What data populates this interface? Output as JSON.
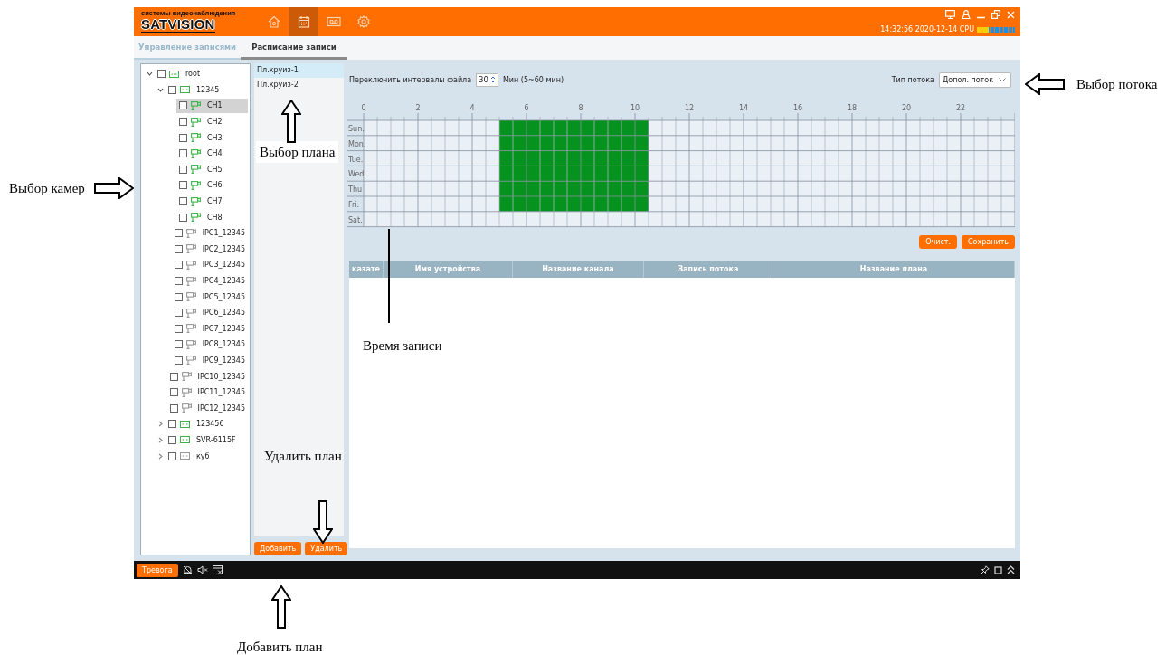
{
  "header": {
    "logo_tagline": "системы видеонаблюдения",
    "logo_brand": "SATVISION",
    "nav": [
      {
        "kind": "home",
        "selected": false
      },
      {
        "kind": "schedule",
        "selected": true
      },
      {
        "kind": "playback",
        "selected": false
      },
      {
        "kind": "settings",
        "selected": false
      }
    ],
    "clock": "14:32:56 2020-12-14 CPU",
    "cpu": {
      "level": 0.3
    }
  },
  "tabs": [
    {
      "label": "Управление записями",
      "selected": false
    },
    {
      "label": "Расписание записи",
      "selected": true
    }
  ],
  "tree": [
    {
      "kind": "device",
      "label": "root",
      "online": true,
      "checked": false,
      "expanded": true,
      "selected": false,
      "children": [
        {
          "kind": "device",
          "label": "12345",
          "online": true,
          "checked": false,
          "expanded": true,
          "selected": false,
          "children": [
            {
              "kind": "camera",
              "label": "CH1",
              "online": true,
              "checked": false,
              "selected": true
            },
            {
              "kind": "camera",
              "label": "CH2",
              "online": true,
              "checked": false,
              "selected": false
            },
            {
              "kind": "camera",
              "label": "CH3",
              "online": true,
              "checked": false,
              "selected": false
            },
            {
              "kind": "camera",
              "label": "CH4",
              "online": true,
              "checked": false,
              "selected": false
            },
            {
              "kind": "camera",
              "label": "CH5",
              "online": true,
              "checked": false,
              "selected": false
            },
            {
              "kind": "camera",
              "label": "CH6",
              "online": true,
              "checked": false,
              "selected": false
            },
            {
              "kind": "camera",
              "label": "CH7",
              "online": true,
              "checked": false,
              "selected": false
            },
            {
              "kind": "camera",
              "label": "CH8",
              "online": true,
              "checked": false,
              "selected": false
            },
            {
              "kind": "camera",
              "label": "IPC1_12345",
              "online": false,
              "checked": false,
              "selected": false
            },
            {
              "kind": "camera",
              "label": "IPC2_12345",
              "online": false,
              "checked": false,
              "selected": false
            },
            {
              "kind": "camera",
              "label": "IPC3_12345",
              "online": false,
              "checked": false,
              "selected": false
            },
            {
              "kind": "camera",
              "label": "IPC4_12345",
              "online": false,
              "checked": false,
              "selected": false
            },
            {
              "kind": "camera",
              "label": "IPC5_12345",
              "online": false,
              "checked": false,
              "selected": false
            },
            {
              "kind": "camera",
              "label": "IPC6_12345",
              "online": false,
              "checked": false,
              "selected": false
            },
            {
              "kind": "camera",
              "label": "IPC7_12345",
              "online": false,
              "checked": false,
              "selected": false
            },
            {
              "kind": "camera",
              "label": "IPC8_12345",
              "online": false,
              "checked": false,
              "selected": false
            },
            {
              "kind": "camera",
              "label": "IPC9_12345",
              "online": false,
              "checked": false,
              "selected": false
            },
            {
              "kind": "camera",
              "label": "IPC10_12345",
              "online": false,
              "checked": false,
              "selected": false
            },
            {
              "kind": "camera",
              "label": "IPC11_12345",
              "online": false,
              "checked": false,
              "selected": false
            },
            {
              "kind": "camera",
              "label": "IPC12_12345",
              "online": false,
              "checked": false,
              "selected": false
            }
          ]
        },
        {
          "kind": "device",
          "label": "123456",
          "online": true,
          "checked": false,
          "expanded": false,
          "selected": false
        },
        {
          "kind": "device",
          "label": "SVR-6115F",
          "online": true,
          "checked": false,
          "expanded": false,
          "selected": false
        },
        {
          "kind": "device",
          "label": "куб",
          "online": false,
          "checked": false,
          "expanded": false,
          "selected": false
        }
      ]
    }
  ],
  "plans": {
    "items": [
      {
        "label": "Пл.круиз-1",
        "selected": true
      },
      {
        "label": "Пл.круиз-2",
        "selected": false
      }
    ],
    "add_button": "Добавить",
    "delete_button": "Удалить"
  },
  "settings": {
    "interval_label": "Переключить интервалы файла",
    "interval_value": "30",
    "interval_hint": "Мин (5~60 мин)",
    "stream_label": "Тип потока",
    "stream_value": "Допол. поток"
  },
  "schedule": {
    "hours": [
      "0",
      "2",
      "4",
      "6",
      "8",
      "10",
      "12",
      "14",
      "16",
      "18",
      "20",
      "22"
    ],
    "days": [
      {
        "day": "Sun.",
        "slots": [
          false,
          false,
          false,
          false,
          false,
          false,
          false,
          false,
          false,
          false,
          true,
          true,
          true,
          true,
          true,
          true,
          true,
          true,
          true,
          true,
          true,
          false,
          false,
          false,
          false,
          false,
          false,
          false,
          false,
          false,
          false,
          false,
          false,
          false,
          false,
          false,
          false,
          false,
          false,
          false,
          false,
          false,
          false,
          false,
          false,
          false,
          false,
          false
        ]
      },
      {
        "day": "Mon.",
        "slots": [
          false,
          false,
          false,
          false,
          false,
          false,
          false,
          false,
          false,
          false,
          true,
          true,
          true,
          true,
          true,
          true,
          true,
          true,
          true,
          true,
          true,
          false,
          false,
          false,
          false,
          false,
          false,
          false,
          false,
          false,
          false,
          false,
          false,
          false,
          false,
          false,
          false,
          false,
          false,
          false,
          false,
          false,
          false,
          false,
          false,
          false,
          false,
          false
        ]
      },
      {
        "day": "Tue.",
        "slots": [
          false,
          false,
          false,
          false,
          false,
          false,
          false,
          false,
          false,
          false,
          true,
          true,
          true,
          true,
          true,
          true,
          true,
          true,
          true,
          true,
          true,
          false,
          false,
          false,
          false,
          false,
          false,
          false,
          false,
          false,
          false,
          false,
          false,
          false,
          false,
          false,
          false,
          false,
          false,
          false,
          false,
          false,
          false,
          false,
          false,
          false,
          false,
          false
        ]
      },
      {
        "day": "Wed.",
        "slots": [
          false,
          false,
          false,
          false,
          false,
          false,
          false,
          false,
          false,
          false,
          true,
          true,
          true,
          true,
          true,
          true,
          true,
          true,
          true,
          true,
          true,
          false,
          false,
          false,
          false,
          false,
          false,
          false,
          false,
          false,
          false,
          false,
          false,
          false,
          false,
          false,
          false,
          false,
          false,
          false,
          false,
          false,
          false,
          false,
          false,
          false,
          false,
          false
        ]
      },
      {
        "day": "Thu",
        "slots": [
          false,
          false,
          false,
          false,
          false,
          false,
          false,
          false,
          false,
          false,
          true,
          true,
          true,
          true,
          true,
          true,
          true,
          true,
          true,
          true,
          true,
          false,
          false,
          false,
          false,
          false,
          false,
          false,
          false,
          false,
          false,
          false,
          false,
          false,
          false,
          false,
          false,
          false,
          false,
          false,
          false,
          false,
          false,
          false,
          false,
          false,
          false,
          false
        ]
      },
      {
        "day": "Fri.",
        "slots": [
          false,
          false,
          false,
          false,
          false,
          false,
          false,
          false,
          false,
          false,
          true,
          true,
          true,
          true,
          true,
          true,
          true,
          true,
          true,
          true,
          true,
          false,
          false,
          false,
          false,
          false,
          false,
          false,
          false,
          false,
          false,
          false,
          false,
          false,
          false,
          false,
          false,
          false,
          false,
          false,
          false,
          false,
          false,
          false,
          false,
          false,
          false,
          false
        ]
      },
      {
        "day": "Sat.",
        "slots": [
          false,
          false,
          false,
          false,
          false,
          false,
          false,
          false,
          false,
          false,
          false,
          false,
          false,
          false,
          false,
          false,
          false,
          false,
          false,
          false,
          false,
          false,
          false,
          false,
          false,
          false,
          false,
          false,
          false,
          false,
          false,
          false,
          false,
          false,
          false,
          false,
          false,
          false,
          false,
          false,
          false,
          false,
          false,
          false,
          false,
          false,
          false,
          false
        ]
      }
    ],
    "clear_button": "Очист.",
    "save_button": "Сохранить"
  },
  "table": {
    "columns": [
      "казате",
      "Имя устройства",
      "Название канала",
      "Запись потока",
      "Название плана"
    ]
  },
  "footer": {
    "alarm_button": "Тревога"
  },
  "annotations": [
    {
      "text": "Выбор камер",
      "kind": "right"
    },
    {
      "text": "Выбор плана",
      "kind": "up"
    },
    {
      "text": "Выбор потока",
      "kind": "left"
    },
    {
      "text": "Время записи",
      "kind": "line"
    },
    {
      "text": "Удалить план",
      "kind": "down"
    },
    {
      "text": "Добавить план",
      "kind": "up"
    }
  ]
}
